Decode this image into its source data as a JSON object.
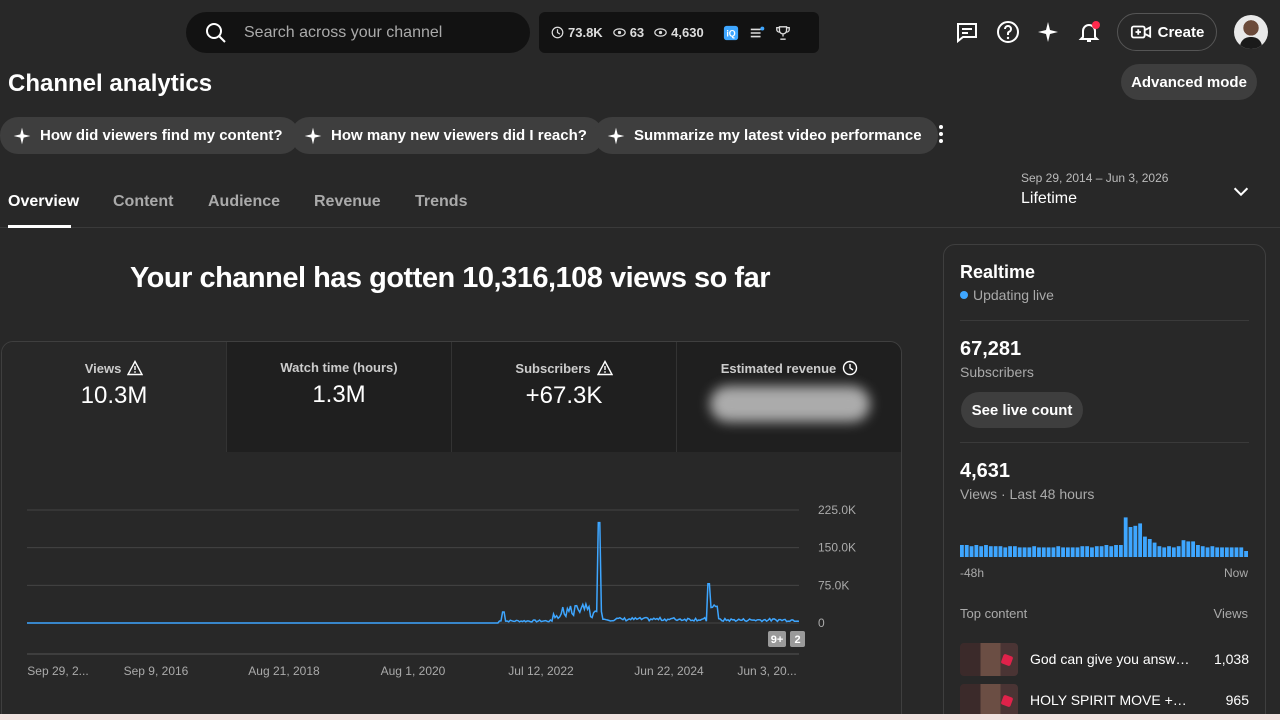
{
  "topbar": {
    "search_placeholder": "Search across your channel",
    "stats": [
      {
        "icon": "clock-icon",
        "value": "73.8K"
      },
      {
        "icon": "eye-icon",
        "value": "63"
      },
      {
        "icon": "eye-icon",
        "value": "4,630"
      }
    ],
    "create_label": "Create"
  },
  "page": {
    "title": "Channel analytics",
    "advanced_label": "Advanced mode"
  },
  "chips": [
    "How did viewers find my content?",
    "How many new viewers did I reach?",
    "Summarize my latest video performance"
  ],
  "tabs": [
    {
      "label": "Overview",
      "active": true
    },
    {
      "label": "Content",
      "active": false
    },
    {
      "label": "Audience",
      "active": false
    },
    {
      "label": "Revenue",
      "active": false
    },
    {
      "label": "Trends",
      "active": false
    }
  ],
  "date_range": {
    "range": "Sep 29, 2014 – Jun 3, 2026",
    "label": "Lifetime"
  },
  "headline": "Your channel has gotten 10,316,108 views so far",
  "metrics": [
    {
      "label": "Views",
      "value": "10.3M",
      "icon": "warning-icon"
    },
    {
      "label": "Watch time (hours)",
      "value": "1.3M",
      "icon": ""
    },
    {
      "label": "Subscribers",
      "value": "+67.3K",
      "icon": "warning-icon"
    },
    {
      "label": "Estimated revenue",
      "value": "",
      "icon": "clock-icon"
    }
  ],
  "chart_data": {
    "type": "line",
    "series_color": "#3ea6ff",
    "x_tick_labels": [
      "Sep 29, 2...",
      "Sep 9, 2016",
      "Aug 21, 2018",
      "Aug 1, 2020",
      "Jul 12, 2022",
      "Jun 22, 2024",
      "Jun 3, 20..."
    ],
    "y_tick_labels": [
      "225.0K",
      "150.0K",
      "75.0K",
      "0"
    ],
    "ylim": [
      0,
      225000
    ],
    "badges": [
      "9+",
      "2"
    ],
    "grid": true
  },
  "realtime": {
    "title": "Realtime",
    "status": "Updating live",
    "subscribers_value": "67,281",
    "subscribers_label": "Subscribers",
    "live_count_label": "See live count",
    "views_value": "4,631",
    "views_label": "Views · Last 48 hours",
    "axis_start": "-48h",
    "axis_end": "Now",
    "bars": [
      10,
      10,
      9,
      10,
      9,
      10,
      9,
      9,
      9,
      8,
      9,
      9,
      8,
      8,
      8,
      9,
      8,
      8,
      8,
      8,
      9,
      8,
      8,
      8,
      8,
      9,
      9,
      8,
      9,
      9,
      10,
      9,
      10,
      10,
      33,
      25,
      26,
      28,
      17,
      15,
      12,
      9,
      8,
      9,
      8,
      9,
      14,
      13,
      13,
      10,
      9,
      8,
      9,
      8,
      8,
      8,
      8,
      8,
      8,
      5
    ],
    "top_content_label": "Top content",
    "views_col_label": "Views",
    "top_content": [
      {
        "title": "God can give you answer...",
        "views": "1,038"
      },
      {
        "title": "HOLY SPIRIT MOVE +INST...",
        "views": "965"
      }
    ]
  }
}
